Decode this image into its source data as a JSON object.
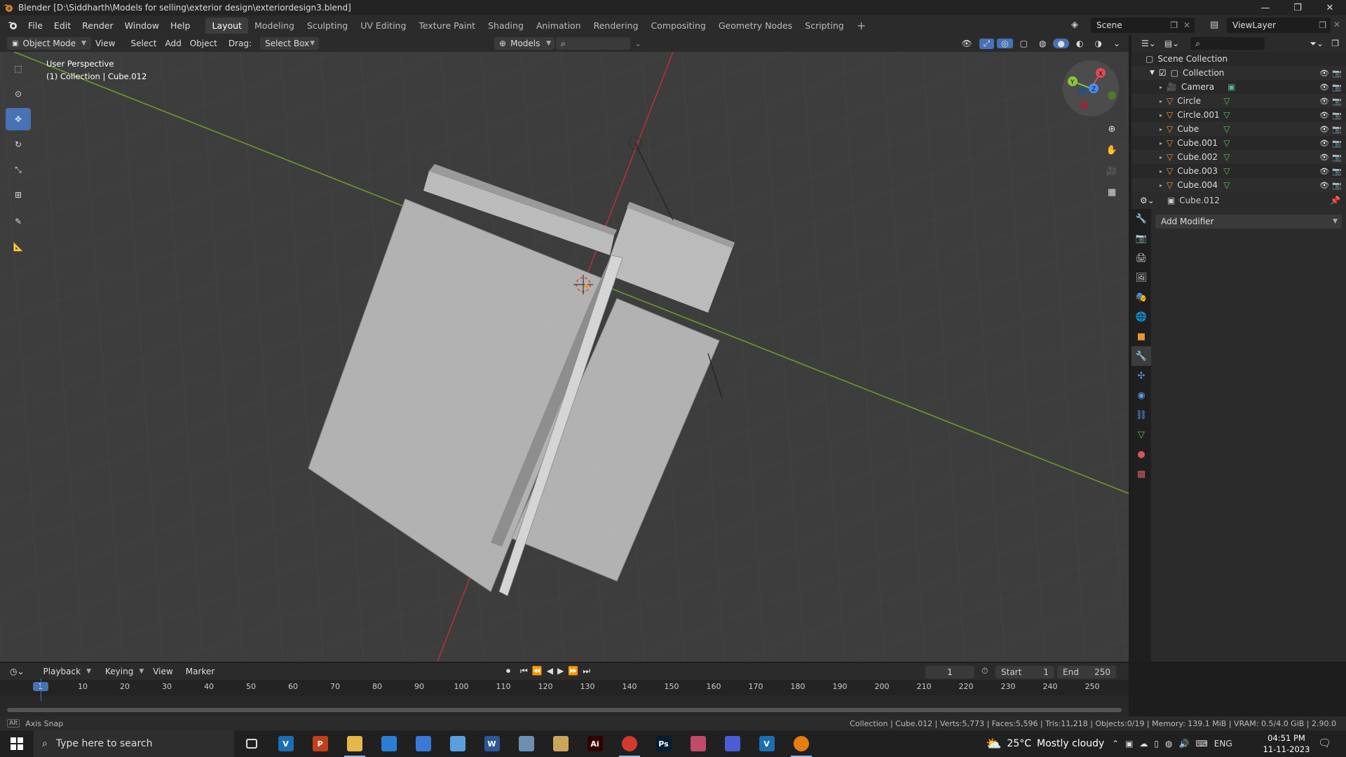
{
  "window": {
    "title": "Blender [D:\\Siddharth\\Models for selling\\exterior design\\exteriordesign3.blend]",
    "controls": [
      "—",
      "❐",
      "✕"
    ]
  },
  "menu": [
    "File",
    "Edit",
    "Render",
    "Window",
    "Help"
  ],
  "workspaces": [
    {
      "label": "Layout",
      "active": true
    },
    {
      "label": "Modeling"
    },
    {
      "label": "Sculpting"
    },
    {
      "label": "UV Editing"
    },
    {
      "label": "Texture Paint"
    },
    {
      "label": "Shading"
    },
    {
      "label": "Animation"
    },
    {
      "label": "Rendering"
    },
    {
      "label": "Compositing"
    },
    {
      "label": "Geometry Nodes"
    },
    {
      "label": "Scripting"
    }
  ],
  "scene": {
    "name": "Scene",
    "view_layer": "ViewLayer"
  },
  "viewport_header": {
    "mode": "Object Mode",
    "view": "View",
    "select": "Select",
    "add": "Add",
    "object": "Object",
    "drag_label": "Drag:",
    "drag_value": "Select Box",
    "orientation": "Models"
  },
  "viewport": {
    "overlay_line1": "User Perspective",
    "overlay_line2": "(1) Collection | Cube.012",
    "gizmo_axes": [
      "X",
      "Y",
      "Z"
    ]
  },
  "outliner": {
    "root": "Scene Collection",
    "collection": "Collection",
    "items": [
      {
        "name": "Camera",
        "type": "camera"
      },
      {
        "name": "Circle",
        "type": "mesh"
      },
      {
        "name": "Circle.001",
        "type": "mesh"
      },
      {
        "name": "Cube",
        "type": "mesh"
      },
      {
        "name": "Cube.001",
        "type": "mesh"
      },
      {
        "name": "Cube.002",
        "type": "mesh"
      },
      {
        "name": "Cube.003",
        "type": "mesh"
      },
      {
        "name": "Cube.004",
        "type": "mesh"
      }
    ]
  },
  "properties": {
    "object_name": "Cube.012",
    "add_modifier": "Add Modifier"
  },
  "timeline": {
    "playback": "Playback",
    "keying": "Keying",
    "view": "View",
    "marker": "Marker",
    "current_frame": "1",
    "start_label": "Start",
    "start": "1",
    "end_label": "End",
    "end": "250",
    "ticks": [
      "1",
      "10",
      "20",
      "30",
      "40",
      "50",
      "60",
      "70",
      "80",
      "90",
      "100",
      "110",
      "120",
      "130",
      "140",
      "150",
      "160",
      "170",
      "180",
      "190",
      "200",
      "210",
      "220",
      "230",
      "240",
      "250"
    ]
  },
  "statusbar": {
    "left": "Axis Snap",
    "left_key": "Alt",
    "right": "Collection | Cube.012 | Verts:5,773 | Faces:5,596 | Tris:11,218 | Objects:0/19 | Memory: 139.1 MiB | VRAM: 0.5/4.0 GiB | 2.90.0"
  },
  "taskbar": {
    "search_placeholder": "Type here to search",
    "weather_temp": "25°C",
    "weather_text": "Mostly cloudy",
    "lang": "ENG",
    "time": "04:51 PM",
    "date": "11-11-2023",
    "apps": [
      {
        "name": "task-view",
        "label": "",
        "color": "#202020"
      },
      {
        "name": "vectorworks",
        "label": "V",
        "color": "#1a6fb3"
      },
      {
        "name": "powerpoint",
        "label": "P",
        "color": "#c43e1c"
      },
      {
        "name": "file-explorer",
        "label": "",
        "color": "#e8b74a"
      },
      {
        "name": "outlook",
        "label": "",
        "color": "#2a7fd4"
      },
      {
        "name": "store",
        "label": "",
        "color": "#3b78d8"
      },
      {
        "name": "pen",
        "label": "",
        "color": "#5aa0e0"
      },
      {
        "name": "word",
        "label": "W",
        "color": "#2b579a"
      },
      {
        "name": "notepad",
        "label": "",
        "color": "#6e8fb4"
      },
      {
        "name": "tools",
        "label": "",
        "color": "#c9a65a"
      },
      {
        "name": "illustrator",
        "label": "Ai",
        "color": "#330000"
      },
      {
        "name": "chrome",
        "label": "",
        "color": "#d33a2c"
      },
      {
        "name": "photoshop",
        "label": "Ps",
        "color": "#001e36"
      },
      {
        "name": "paint",
        "label": "",
        "color": "#c44a6a"
      },
      {
        "name": "app-blue",
        "label": "",
        "color": "#4b5cd6"
      },
      {
        "name": "vectorworks-2",
        "label": "V",
        "color": "#1a6fb3"
      },
      {
        "name": "blender",
        "label": "",
        "color": "#e87d0d"
      }
    ]
  },
  "colors": {
    "x_axis": "#d03a3a",
    "y_axis": "#7ab51d",
    "accent": "#4772b3",
    "active_frame": "#4772b3"
  }
}
